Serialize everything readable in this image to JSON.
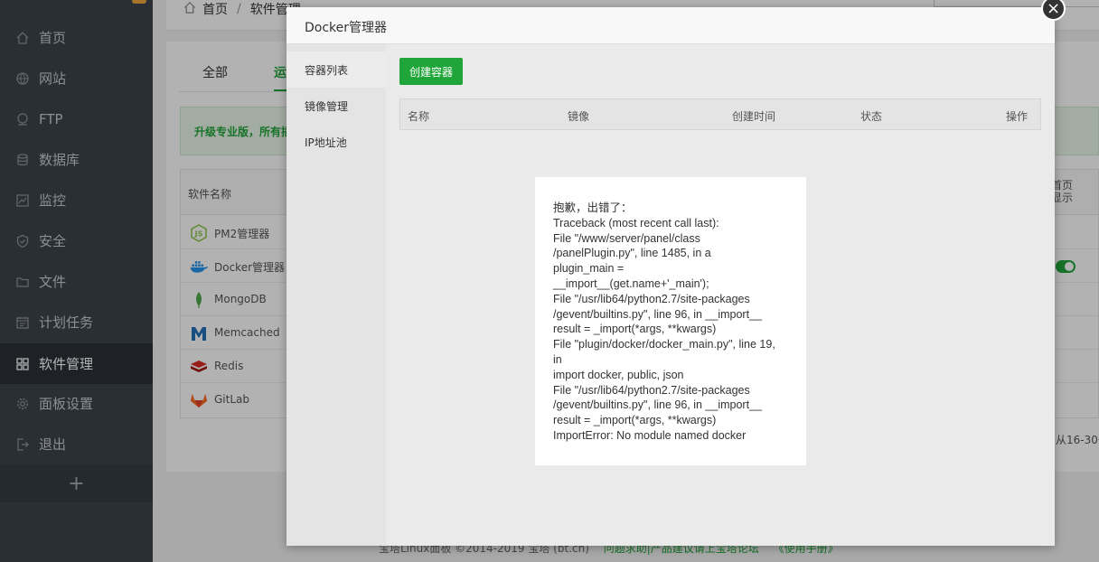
{
  "sidebar": {
    "items": [
      {
        "label": "首页",
        "icon": "home-icon"
      },
      {
        "label": "网站",
        "icon": "globe-icon"
      },
      {
        "label": "FTP",
        "icon": "ftp-icon"
      },
      {
        "label": "数据库",
        "icon": "database-icon"
      },
      {
        "label": "监控",
        "icon": "monitor-icon"
      },
      {
        "label": "安全",
        "icon": "shield-icon"
      },
      {
        "label": "文件",
        "icon": "folder-icon"
      },
      {
        "label": "计划任务",
        "icon": "calendar-icon"
      },
      {
        "label": "软件管理",
        "icon": "grid-icon",
        "active": true
      },
      {
        "label": "面板设置",
        "icon": "gear-icon"
      },
      {
        "label": "退出",
        "icon": "logout-icon"
      }
    ],
    "add_label": "+"
  },
  "breadcrumb": {
    "home": "首页",
    "separator": "/",
    "current": "软件管理"
  },
  "tabs": {
    "all": "全部",
    "partial": "运"
  },
  "promo": "升级专业版，所有插",
  "soft_table": {
    "header_name": "软件名称",
    "header_right": "首页显示",
    "rows": [
      {
        "name": "PM2管理器",
        "icon": "nodejs-icon"
      },
      {
        "name": "Docker管理器",
        "icon": "docker-icon"
      },
      {
        "name": "MongoDB",
        "icon": "mongodb-icon"
      },
      {
        "name": "Memcached",
        "icon": "memcached-icon"
      },
      {
        "name": "Redis",
        "icon": "redis-icon"
      },
      {
        "name": "GitLab",
        "icon": "gitlab-icon"
      }
    ]
  },
  "pager": "从16-30条",
  "footer": {
    "copyright": "宝塔Linux面板 ©2014-2019 宝塔 (bt.cn)",
    "link1": "问题求助|产品建议请上宝塔论坛",
    "link2": "《使用手册》"
  },
  "modal": {
    "title": "Docker管理器",
    "close": "×",
    "nav": [
      "容器列表",
      "镜像管理",
      "IP地址池"
    ],
    "create_button": "创建容器",
    "columns": [
      "名称",
      "镜像",
      "创建时间",
      "状态",
      "操作"
    ]
  },
  "error": {
    "lines": [
      "抱歉，出错了：",
      "Traceback (most recent call last):",
      "File \"/www/server/panel/class",
      "/panelPlugin.py\", line 1485, in a",
      "plugin_main =",
      "__import__(get.name+'_main');",
      "File \"/usr/lib64/python2.7/site-packages",
      "/gevent/builtins.py\", line 96, in __import__",
      "result = _import(*args, **kwargs)",
      "File \"plugin/docker/docker_main.py\", line 19,",
      "in",
      "import docker, public, json",
      "File \"/usr/lib64/python2.7/site-packages",
      "/gevent/builtins.py\", line 96, in __import__",
      "result = _import(*args, **kwargs)",
      "ImportError: No module named docker"
    ]
  },
  "colors": {
    "accent": "#20a53a",
    "sidebar": "#3c444d",
    "sidebar_active": "#2c3238"
  }
}
